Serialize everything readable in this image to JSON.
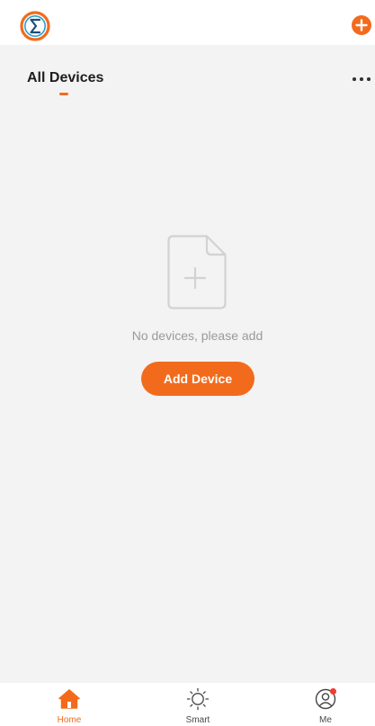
{
  "header": {
    "logo_icon": "app-logo-icon",
    "add_icon": "plus-circle-icon"
  },
  "tabs": {
    "active_label": "All Devices",
    "more_icon": "more-dots-icon"
  },
  "empty_state": {
    "icon": "empty-document-plus-icon",
    "message": "No devices, please add",
    "button_label": "Add Device"
  },
  "bottom_nav": {
    "items": [
      {
        "label": "Home",
        "icon": "home-icon",
        "active": true
      },
      {
        "label": "Smart",
        "icon": "sun-icon",
        "active": false
      },
      {
        "label": "Me",
        "icon": "user-icon",
        "active": false,
        "badge": true
      }
    ]
  },
  "colors": {
    "accent": "#f26b1d",
    "background": "#f3f3f3",
    "badge": "#f23a2f"
  }
}
